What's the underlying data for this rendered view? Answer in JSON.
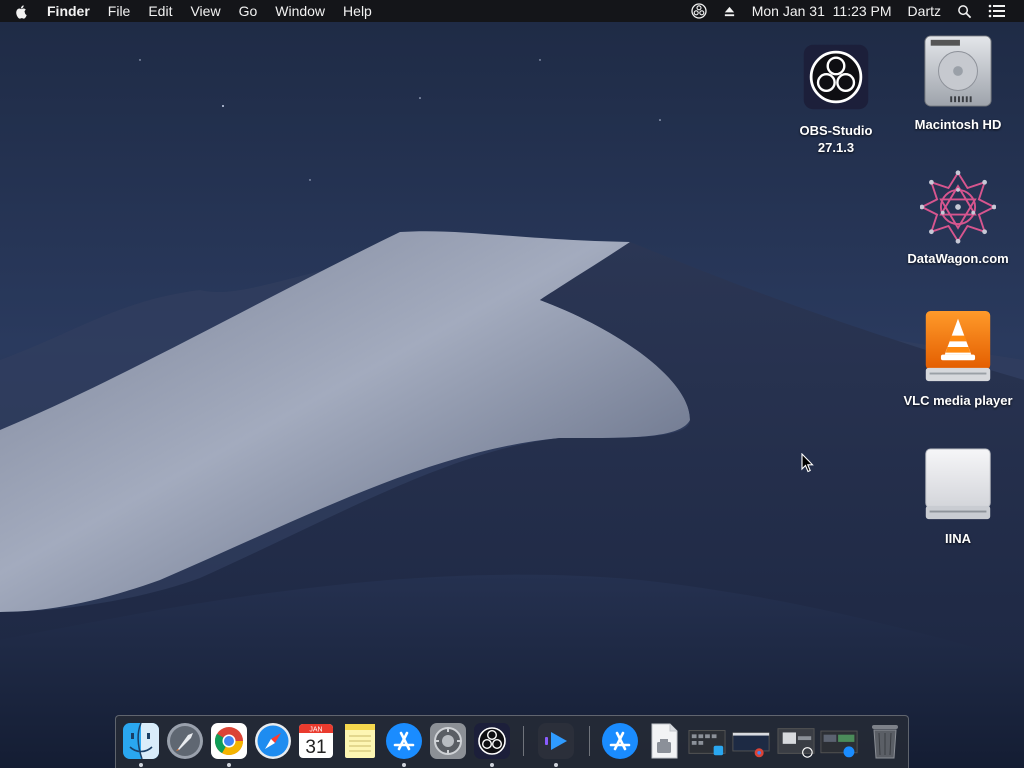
{
  "menubar": {
    "app_name": "Finder",
    "menus": [
      "File",
      "Edit",
      "View",
      "Go",
      "Window",
      "Help"
    ],
    "clock": "Mon Jan 31  11:23 PM",
    "user": "Dartz",
    "status_icons": [
      "obs-status-icon",
      "eject-icon",
      "spotlight-search-icon",
      "notification-center-icon"
    ]
  },
  "desktop": {
    "icons": [
      {
        "label": "OBS-Studio\n27.1.3",
        "line1": "OBS-Studio",
        "line2": "27.1.3",
        "icon": "obs-icon"
      },
      {
        "label": "Macintosh HD",
        "icon": "hard-drive-icon"
      },
      {
        "label": "DataWagon.com",
        "icon": "datawagon-icon"
      },
      {
        "label": "VLC media player",
        "icon": "vlc-disk-icon"
      },
      {
        "label": "IINA",
        "icon": "external-drive-icon"
      }
    ]
  },
  "dock": {
    "apps": [
      {
        "name": "Finder",
        "icon": "finder-icon",
        "running": true
      },
      {
        "name": "Launchpad",
        "icon": "launchpad-icon",
        "running": false
      },
      {
        "name": "Google Chrome",
        "icon": "chrome-icon",
        "running": true
      },
      {
        "name": "Safari",
        "icon": "safari-icon",
        "running": false
      },
      {
        "name": "Calendar",
        "icon": "calendar-icon",
        "running": false,
        "month": "JAN",
        "day": "31"
      },
      {
        "name": "Notes",
        "icon": "notes-icon",
        "running": false
      },
      {
        "name": "App Store",
        "icon": "app-store-icon",
        "running": true
      },
      {
        "name": "System Preferences",
        "icon": "system-preferences-icon",
        "running": false
      },
      {
        "name": "OBS",
        "icon": "obs-icon",
        "running": true
      },
      {
        "name": "Infuse",
        "icon": "media-player-icon",
        "running": true
      },
      {
        "name": "App Store Downloads",
        "icon": "downloads-stack-icon",
        "running": false
      },
      {
        "name": "Document",
        "icon": "document-icon",
        "running": false
      },
      {
        "name": "Minimized Window 1",
        "icon": "window-thumbnail-icon",
        "running": false
      },
      {
        "name": "Minimized Window 2",
        "icon": "window-thumbnail-icon",
        "running": false
      },
      {
        "name": "Minimized Window 3",
        "icon": "window-thumbnail-icon",
        "running": false
      },
      {
        "name": "Minimized Window 4",
        "icon": "window-thumbnail-icon",
        "running": false
      },
      {
        "name": "Trash",
        "icon": "trash-icon",
        "running": false
      }
    ]
  },
  "colors": {
    "menubar_bg": "#141416",
    "wallpaper_sky": "#26355a",
    "dune_light": "#9aa3b8",
    "dune_shadow": "#27324f"
  }
}
